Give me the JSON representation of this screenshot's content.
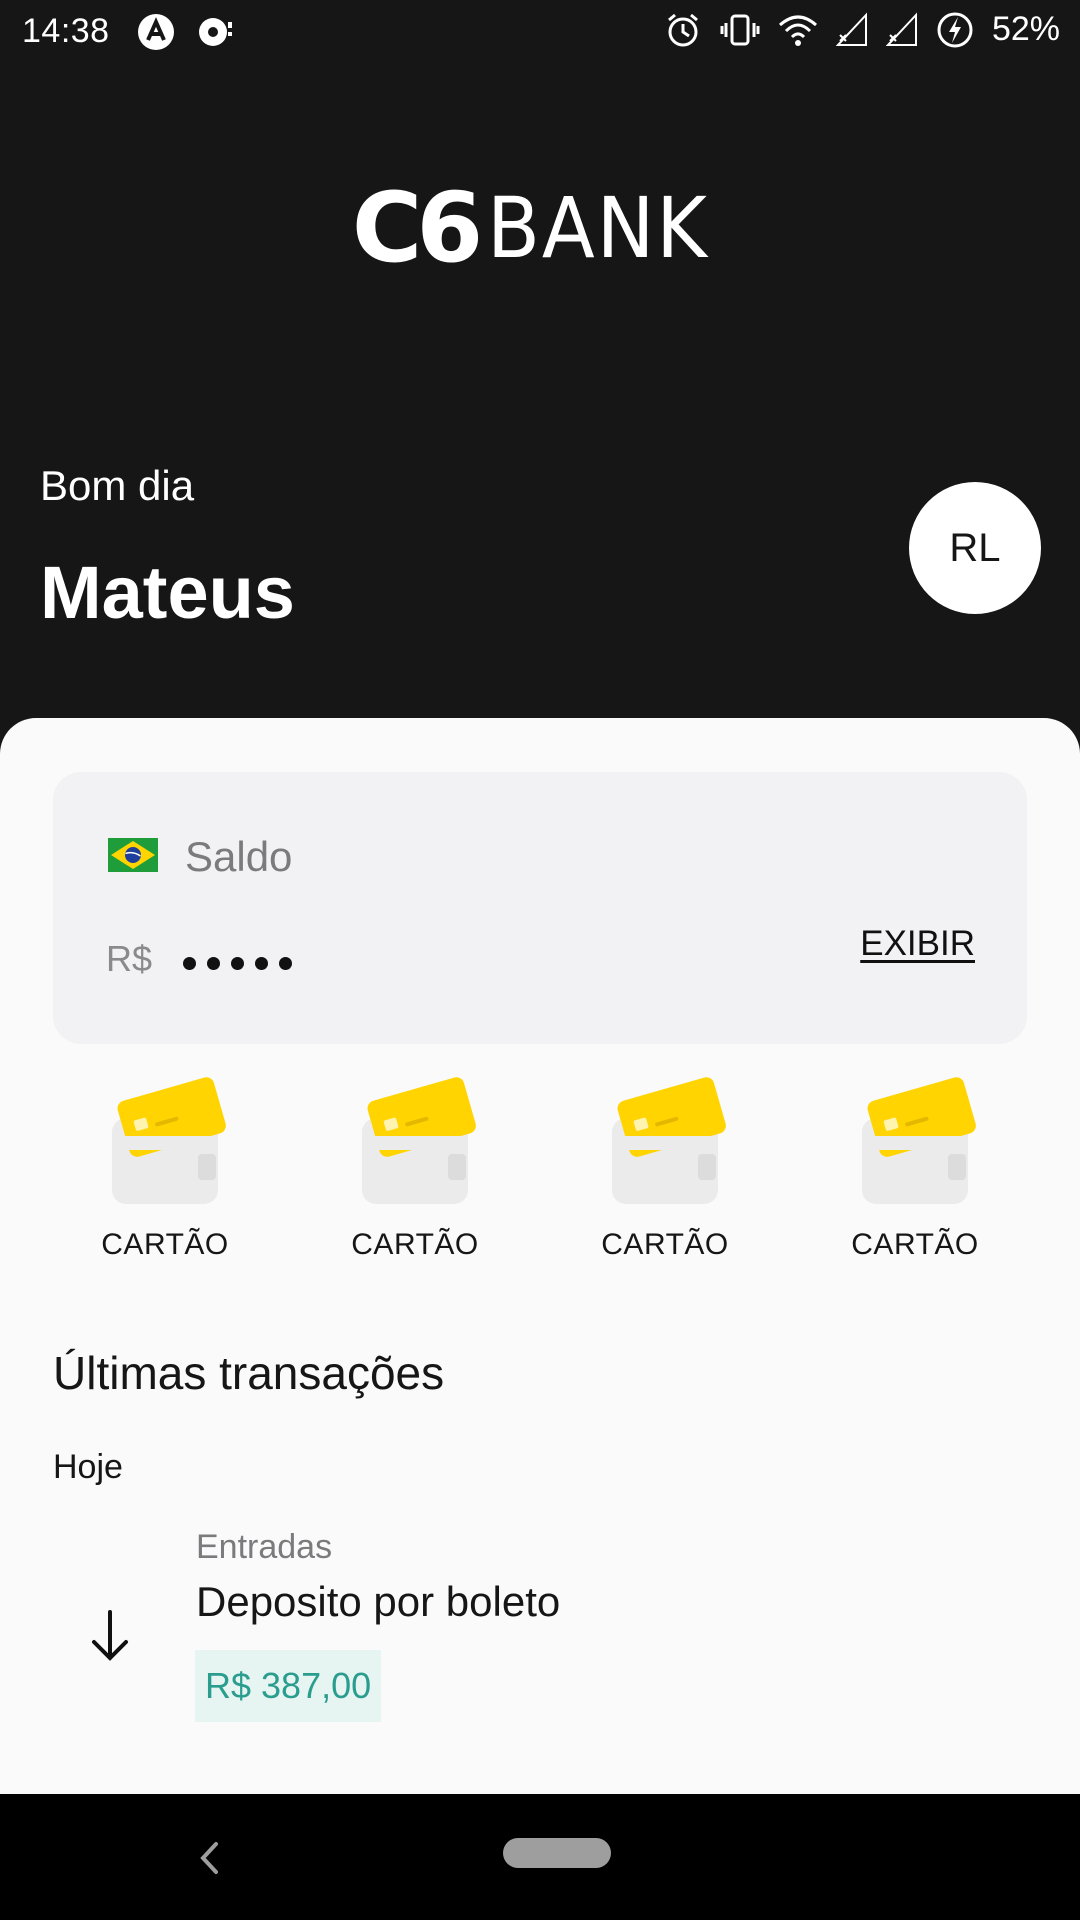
{
  "status_bar": {
    "time": "14:38",
    "battery_percent": "52%",
    "left_icons": [
      "lastpass-icon",
      "media-icon"
    ],
    "right_icons": [
      "alarm-icon",
      "vibrate-icon",
      "wifi-icon",
      "signal-icon",
      "signal-icon",
      "battery-charging-icon"
    ]
  },
  "brand": {
    "c6": "C6",
    "bank": "BANK"
  },
  "greeting": {
    "salutation": "Bom dia",
    "name": "Mateus",
    "avatar_initials": "RL"
  },
  "balance": {
    "label": "Saldo",
    "currency": "R$",
    "show_button": "EXIBIR",
    "masked_digits": 5
  },
  "cards": [
    {
      "label": "CARTÃO"
    },
    {
      "label": "CARTÃO"
    },
    {
      "label": "CARTÃO"
    },
    {
      "label": "CARTÃO"
    }
  ],
  "transactions": {
    "title": "Últimas transações",
    "groups": [
      {
        "date": "Hoje",
        "items": [
          {
            "type": "Entradas",
            "description": "Deposito por boleto",
            "amount": "R$ 387,00"
          }
        ]
      }
    ]
  },
  "colors": {
    "dark_bg": "#161616",
    "sheet_bg": "#fafafa",
    "card_bg": "#f2f2f4",
    "card_yellow": "#ffd400",
    "amount_green": "#2a9d8f",
    "amount_bg": "#e6f5f1"
  }
}
